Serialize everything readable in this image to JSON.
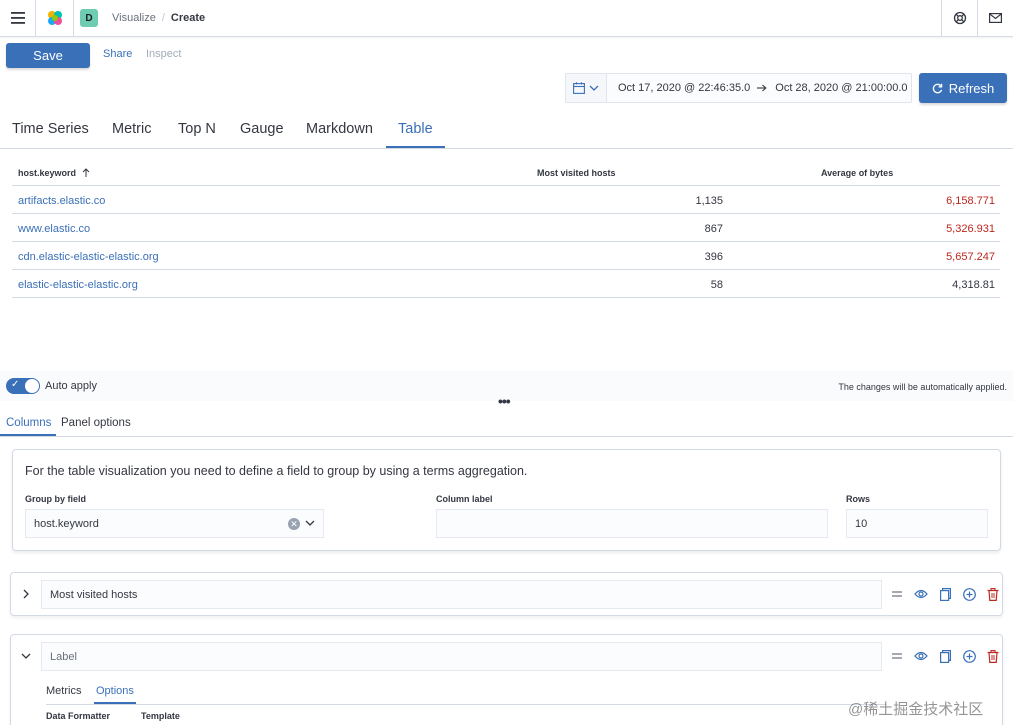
{
  "header": {
    "breadcrumbs": [
      "Visualize",
      "Create"
    ],
    "space_initial": "D"
  },
  "toolbar": {
    "save_label": "Save",
    "share_label": "Share",
    "inspect_label": "Inspect"
  },
  "time": {
    "start": "Oct 17, 2020 @ 22:46:35.0",
    "end": "Oct 28, 2020 @ 21:00:00.0",
    "refresh_label": "Refresh"
  },
  "vis_tabs": [
    {
      "label": "Time Series"
    },
    {
      "label": "Metric"
    },
    {
      "label": "Top N"
    },
    {
      "label": "Gauge"
    },
    {
      "label": "Markdown"
    },
    {
      "label": "Table",
      "active": true
    }
  ],
  "table": {
    "columns": [
      "host.keyword",
      "Most visited hosts",
      "Average of bytes"
    ],
    "rows": [
      {
        "host": "artifacts.elastic.co",
        "visits": "1,135",
        "bytes": "6,158.771",
        "highlight": true
      },
      {
        "host": "www.elastic.co",
        "visits": "867",
        "bytes": "5,326.931",
        "highlight": true
      },
      {
        "host": "cdn.elastic-elastic-elastic.org",
        "visits": "396",
        "bytes": "5,657.247",
        "highlight": true
      },
      {
        "host": "elastic-elastic-elastic.org",
        "visits": "58",
        "bytes": "4,318.81",
        "highlight": false
      }
    ],
    "highlight_color": "#bd271e"
  },
  "editor": {
    "auto_apply_label": "Auto apply",
    "auto_apply_on": true,
    "auto_apply_hint": "The changes will be automatically applied.",
    "tabs": [
      {
        "label": "Columns",
        "active": true
      },
      {
        "label": "Panel options"
      }
    ],
    "panel": {
      "description": "For the table visualization you need to define a field to group by using a terms aggregation.",
      "group_by_label": "Group by field",
      "group_by_value": "host.keyword",
      "column_label_label": "Column label",
      "column_label_value": "",
      "rows_label": "Rows",
      "rows_value": "10"
    },
    "aggregations": [
      {
        "title": "Most visited hosts",
        "expanded": false
      },
      {
        "title": "",
        "placeholder": "Label",
        "expanded": true,
        "tabs": [
          {
            "label": "Metrics"
          },
          {
            "label": "Options",
            "active": true
          }
        ],
        "fields": [
          "Data Formatter",
          "Template"
        ]
      }
    ]
  },
  "watermark": "@稀土掘金技术社区",
  "colors": {
    "accent": "#3a70b8",
    "danger": "#bd271e"
  }
}
